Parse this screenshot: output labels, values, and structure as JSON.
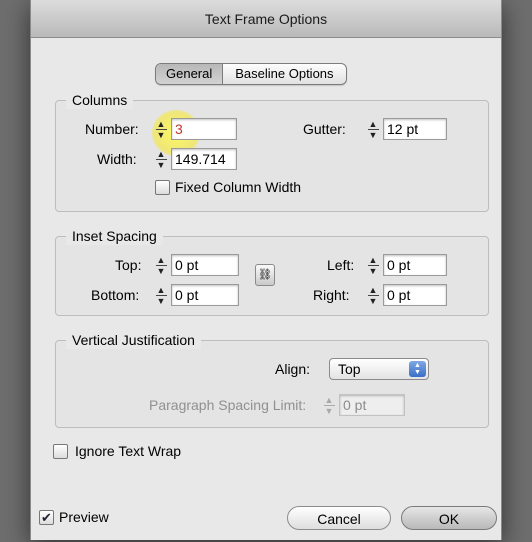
{
  "dialog": {
    "title": "Text Frame Options"
  },
  "tabs": [
    {
      "label": "General",
      "active": true
    },
    {
      "label": "Baseline Options",
      "active": false
    }
  ],
  "columns": {
    "title": "Columns",
    "number_label": "Number:",
    "number_value": "3",
    "gutter_label": "Gutter:",
    "gutter_value": "12 pt",
    "width_label": "Width:",
    "width_value": "149.714",
    "fixed_label": "Fixed Column Width",
    "fixed_checked": false
  },
  "inset": {
    "title": "Inset Spacing",
    "top_label": "Top:",
    "top_value": "0 pt",
    "bottom_label": "Bottom:",
    "bottom_value": "0 pt",
    "left_label": "Left:",
    "left_value": "0 pt",
    "right_label": "Right:",
    "right_value": "0 pt",
    "link_icon": "chain-link-icon"
  },
  "vertical": {
    "title": "Vertical Justification",
    "align_label": "Align:",
    "align_value": "Top",
    "para_label": "Paragraph Spacing Limit:",
    "para_value": "0 pt"
  },
  "ignore_wrap": {
    "label": "Ignore Text Wrap",
    "checked": false
  },
  "preview": {
    "label": "Preview",
    "checked": true
  },
  "buttons": {
    "cancel": "Cancel",
    "ok": "OK"
  },
  "colors": {
    "dialog_bg": "#e8e8e8",
    "highlight": "#f5e83c",
    "select_arrows": "#3a6fc8"
  }
}
